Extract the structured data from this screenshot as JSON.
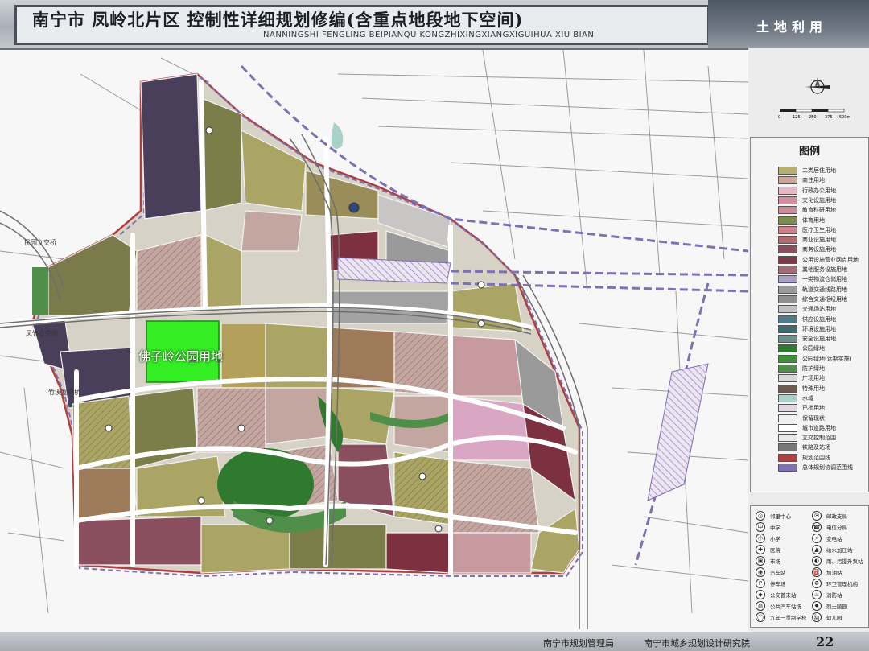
{
  "header": {
    "title_cn": "南宁市 凤岭北片区 控制性详细规划修编(含重点地段地下空间)",
    "title_en": "NANNINGSHI FENGLING BEIPIANQU KONGZHIXINGXIANGXIGUIHUA XIU BIAN",
    "right_text": "土地利用"
  },
  "map": {
    "highlight_label": "佛子岭公园用地",
    "highlight_color": "#33ee22",
    "road_labels": [
      "民园立交桥",
      "凤竹立交桥",
      "竹溪立交桥"
    ],
    "scale_ticks": [
      "0",
      "125",
      "250",
      "375",
      "500m"
    ]
  },
  "legend": {
    "title": "图例",
    "items": [
      {
        "label": "二类居住用地",
        "color": "#b6b070"
      },
      {
        "label": "商住用地",
        "color": "#c9a89b"
      },
      {
        "label": "行政办公用地",
        "color": "#e7b7c6"
      },
      {
        "label": "文化设施用地",
        "color": "#d28ea0"
      },
      {
        "label": "教育科研用地",
        "color": "#c98c9a"
      },
      {
        "label": "体育用地",
        "color": "#7e8c4a"
      },
      {
        "label": "医疗卫生用地",
        "color": "#d07f8a"
      },
      {
        "label": "商业设施用地",
        "color": "#b06a72"
      },
      {
        "label": "商务设施用地",
        "color": "#8a4f5f"
      },
      {
        "label": "公用设施营业网点用地",
        "color": "#7a3a4c"
      },
      {
        "label": "其他服务设施用地",
        "color": "#a36b75"
      },
      {
        "label": "一类物流仓储用地",
        "color": "#a7a0c4"
      },
      {
        "label": "轨道交通线路用地",
        "color": "#9b9b9b"
      },
      {
        "label": "综合交通枢纽用地",
        "color": "#8f8f8f"
      },
      {
        "label": "交通场站用地",
        "color": "#bfbfbf"
      },
      {
        "label": "供应设施用地",
        "color": "#4e7a8a"
      },
      {
        "label": "环境设施用地",
        "color": "#3f6a6e"
      },
      {
        "label": "安全设施用地",
        "color": "#6e8f8a"
      },
      {
        "label": "公园绿地",
        "color": "#2f7a2f"
      },
      {
        "label": "公园绿地(远期实施)",
        "color": "#3f8f3a"
      },
      {
        "label": "防护绿地",
        "color": "#4f8f4a"
      },
      {
        "label": "广场用地",
        "color": "#d8d8d8"
      },
      {
        "label": "特殊用地",
        "color": "#6b5c4f"
      },
      {
        "label": "水域",
        "color": "#a8d2c8"
      },
      {
        "label": "已批用地",
        "color": "#e0d8e0"
      },
      {
        "label": "保留现状",
        "color": "#f0f0f0"
      },
      {
        "label": "城市道路用地",
        "color": "#ffffff"
      },
      {
        "label": "立交控制范围",
        "color": "#e8e8e8"
      },
      {
        "label": "铁路及站场",
        "color": "#777777"
      },
      {
        "label": "规划范围线",
        "color": "#b04040"
      },
      {
        "label": "总体规划协调范围线",
        "color": "#7f6fb5"
      }
    ]
  },
  "symbols": {
    "left": [
      {
        "icon": "◎",
        "label": "邻里中心"
      },
      {
        "icon": "中",
        "label": "中学"
      },
      {
        "icon": "小",
        "label": "小学"
      },
      {
        "icon": "✚",
        "label": "医院"
      },
      {
        "icon": "▣",
        "label": "市场"
      },
      {
        "icon": "◉",
        "label": "汽车站"
      },
      {
        "icon": "P",
        "label": "停车场"
      },
      {
        "icon": "◆",
        "label": "公交首末站"
      },
      {
        "icon": "◍",
        "label": "公共汽车站场"
      },
      {
        "icon": "◯",
        "label": "九年一贯制学校"
      }
    ],
    "right": [
      {
        "icon": "✉",
        "label": "邮政支局"
      },
      {
        "icon": "☎",
        "label": "电信分局"
      },
      {
        "icon": "⚡",
        "label": "变电站"
      },
      {
        "icon": "▲",
        "label": "给水加压站"
      },
      {
        "icon": "◐",
        "label": "雨、污提升泵站"
      },
      {
        "icon": "⛽",
        "label": "加油站"
      },
      {
        "icon": "♻",
        "label": "环卫管理机构"
      },
      {
        "icon": "♨",
        "label": "消防站"
      },
      {
        "icon": "✹",
        "label": "烈士陵园"
      },
      {
        "icon": "幼",
        "label": "幼儿园"
      }
    ]
  },
  "footer": {
    "left": "南宁市规划管理局",
    "right": "南宁市城乡规划设计研究院",
    "page": "22"
  }
}
